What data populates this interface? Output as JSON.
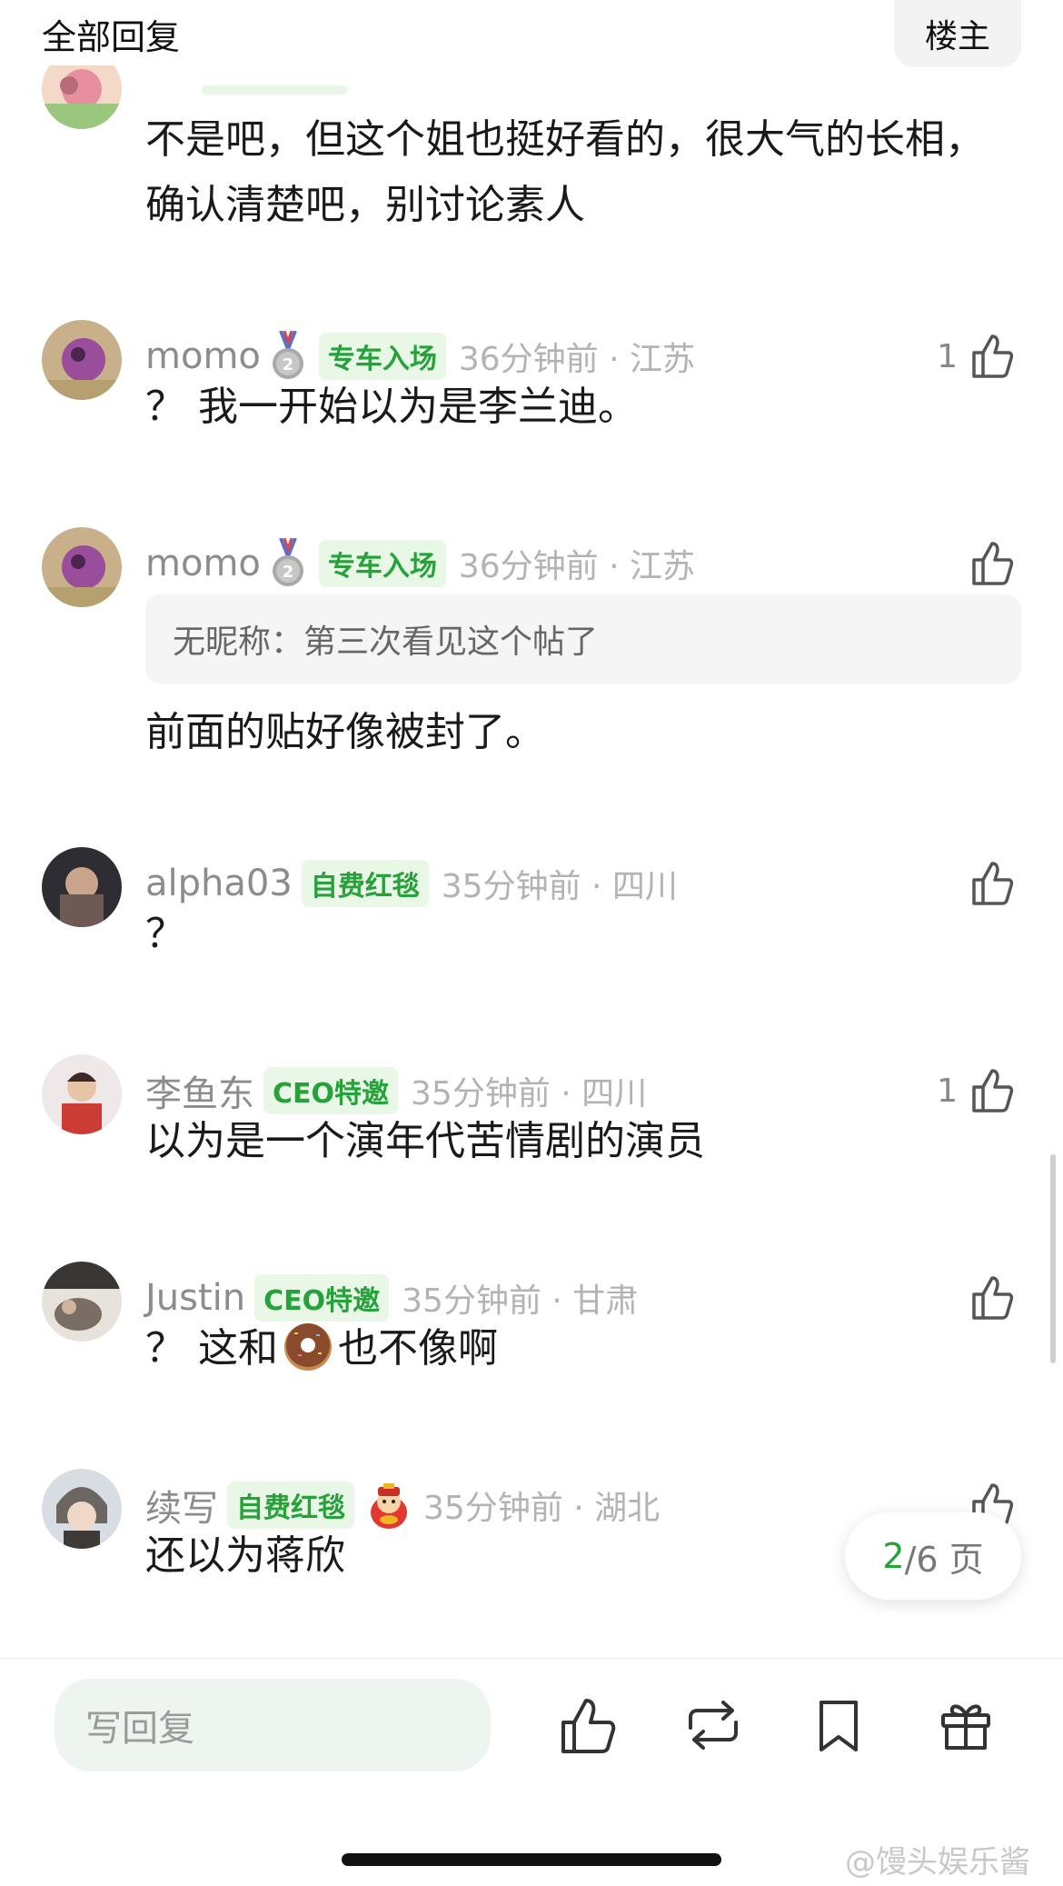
{
  "header": {
    "title": "全部回复",
    "floor_button": "楼主"
  },
  "comments": [
    {
      "body": "不是吧，但这个姐也挺好看的，很大气的长相，确认清楚吧，别讨论素人"
    },
    {
      "username": "momo",
      "medal": "silver-medal-2",
      "tag": "专车入场",
      "time": "36分钟前 · 江苏",
      "likes": "1",
      "body": "？ 我一开始以为是李兰迪。"
    },
    {
      "username": "momo",
      "medal": "silver-medal-2",
      "tag": "专车入场",
      "time": "36分钟前 · 江苏",
      "quote": "无昵称：第三次看见这个帖了",
      "body": "前面的贴好像被封了。"
    },
    {
      "username": "alpha03",
      "tag": "自费红毯",
      "time": "35分钟前 · 四川",
      "body": "？"
    },
    {
      "username": "李鱼东",
      "tag": "CEO特邀",
      "time": "35分钟前 · 四川",
      "likes": "1",
      "body": "以为是一个演年代苦情剧的演员"
    },
    {
      "username": "Justin",
      "tag": "CEO特邀",
      "time": "35分钟前 · 甘肃",
      "body_before": "？ 这和",
      "emoji": "donut-emoji",
      "body_after": "也不像啊"
    },
    {
      "username": "续写",
      "tag": "自费红毯",
      "extra_badge": "fortune-god-badge",
      "time": "35分钟前 · 湖北",
      "body": "还以为蒋欣"
    }
  ],
  "pager": {
    "current": "2",
    "total_text": "/6 页"
  },
  "bottom_bar": {
    "reply_placeholder": "写回复",
    "actions": [
      "like-icon",
      "repost-icon",
      "bookmark-icon",
      "gift-icon"
    ]
  },
  "watermark": "@馒头娱乐酱",
  "colors": {
    "accent_green": "#25a23a",
    "tag_bg": "#e9f7e6",
    "meta_gray": "#8c8c8c"
  }
}
